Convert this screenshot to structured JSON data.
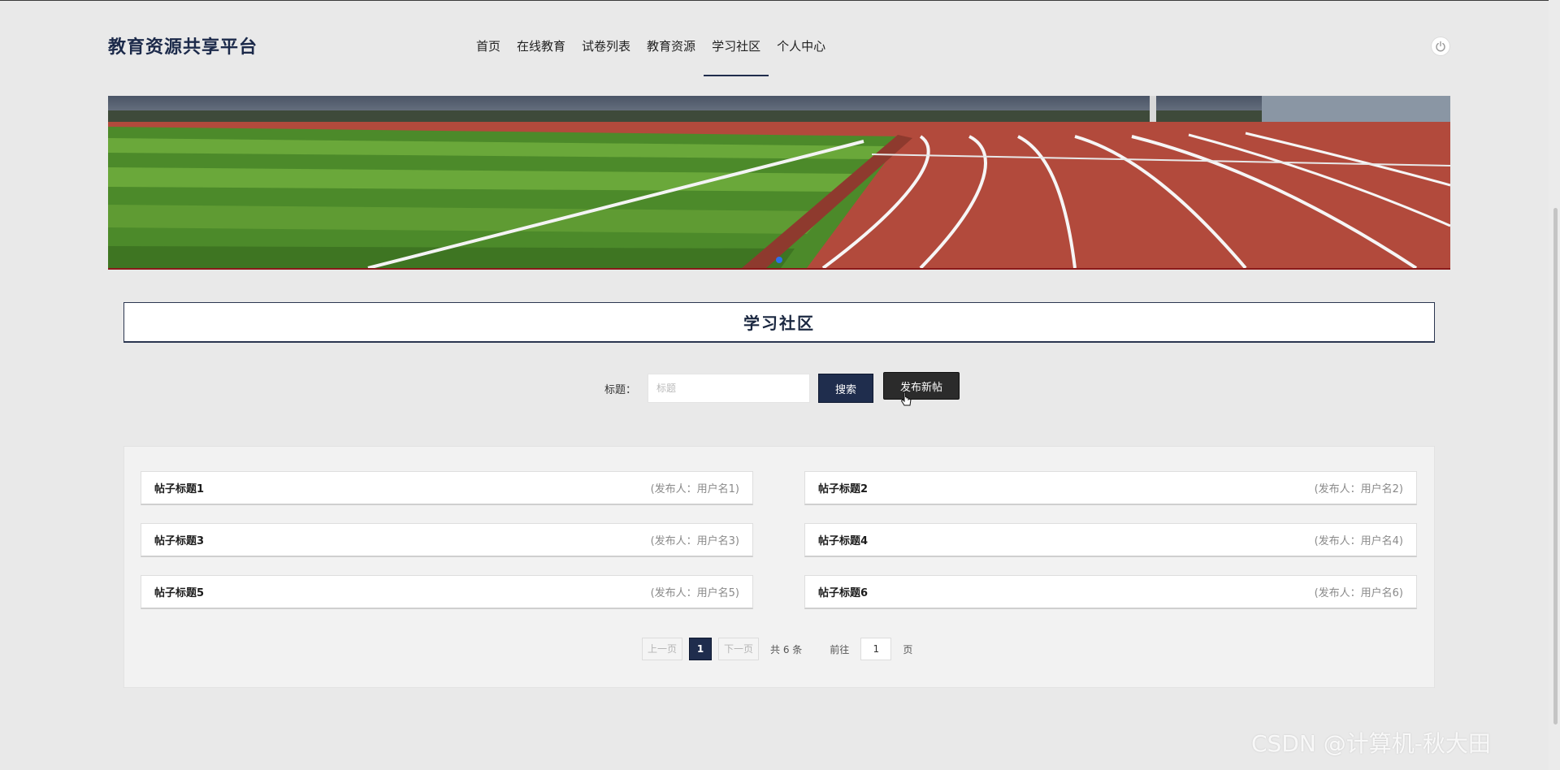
{
  "header": {
    "brand": "教育资源共享平台",
    "nav": [
      {
        "label": "首页"
      },
      {
        "label": "在线教育"
      },
      {
        "label": "试卷列表"
      },
      {
        "label": "教育资源"
      },
      {
        "label": "学习社区"
      },
      {
        "label": "个人中心"
      }
    ],
    "active_nav": "学习社区",
    "power_icon": "power-icon"
  },
  "banner": {
    "dots": 1,
    "active_dot": 1
  },
  "section": {
    "title": "学习社区"
  },
  "search": {
    "label": "标题：",
    "placeholder": "标题",
    "value": "",
    "search_button": "搜索",
    "new_post_button": "发布新帖"
  },
  "posts": [
    {
      "title": "帖子标题1",
      "author": "(发布人：用户名1)"
    },
    {
      "title": "帖子标题2",
      "author": "(发布人：用户名2)"
    },
    {
      "title": "帖子标题3",
      "author": "(发布人：用户名3)"
    },
    {
      "title": "帖子标题4",
      "author": "(发布人：用户名4)"
    },
    {
      "title": "帖子标题5",
      "author": "(发布人：用户名5)"
    },
    {
      "title": "帖子标题6",
      "author": "(发布人：用户名6)"
    }
  ],
  "pagination": {
    "prev": "上一页",
    "next": "下一页",
    "current_page": "1",
    "total": "共 6 条",
    "goto_label": "前往",
    "goto_value": "1",
    "page_unit": "页"
  },
  "watermark": "CSDN @计算机-秋大田",
  "colors": {
    "primary": "#1f2d4d",
    "dark_button": "#2b2b2b",
    "page_bg": "#e9e9e9"
  }
}
